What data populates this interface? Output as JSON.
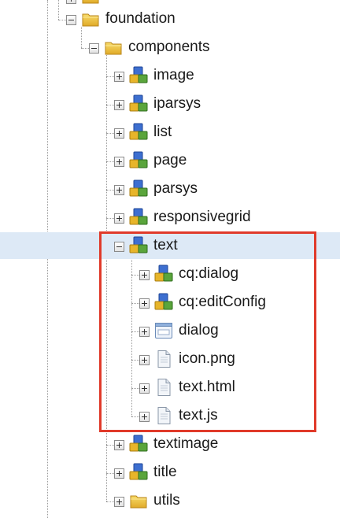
{
  "tree": {
    "rows": [
      {
        "label": "foundation",
        "icon": "folder-icon",
        "expanded": true,
        "level": 0
      },
      {
        "label": "components",
        "icon": "folder-icon",
        "expanded": true,
        "level": 1
      },
      {
        "label": "image",
        "icon": "component-icon",
        "expanded": false,
        "level": 2
      },
      {
        "label": "iparsys",
        "icon": "component-icon",
        "expanded": false,
        "level": 2
      },
      {
        "label": "list",
        "icon": "component-icon",
        "expanded": false,
        "level": 2
      },
      {
        "label": "page",
        "icon": "component-icon",
        "expanded": false,
        "level": 2
      },
      {
        "label": "parsys",
        "icon": "component-icon",
        "expanded": false,
        "level": 2
      },
      {
        "label": "responsivegrid",
        "icon": "component-icon",
        "expanded": false,
        "level": 2
      },
      {
        "label": "text",
        "icon": "component-icon",
        "expanded": true,
        "level": 2,
        "selected": true
      },
      {
        "label": "cq:dialog",
        "icon": "component-icon",
        "expanded": false,
        "level": 3
      },
      {
        "label": "cq:editConfig",
        "icon": "component-icon",
        "expanded": false,
        "level": 3
      },
      {
        "label": "dialog",
        "icon": "dialog-icon",
        "expanded": false,
        "level": 3
      },
      {
        "label": "icon.png",
        "icon": "file-icon",
        "expanded": false,
        "level": 3
      },
      {
        "label": "text.html",
        "icon": "file-icon",
        "expanded": false,
        "level": 3
      },
      {
        "label": "text.js",
        "icon": "file-icon",
        "expanded": false,
        "level": 3
      },
      {
        "label": "textimage",
        "icon": "component-icon",
        "expanded": false,
        "level": 2
      },
      {
        "label": "title",
        "icon": "component-icon",
        "expanded": false,
        "level": 2
      },
      {
        "label": "utils",
        "icon": "folder-icon",
        "expanded": false,
        "level": 2
      }
    ]
  },
  "highlight": {
    "color": "#e03a2a"
  },
  "colors": {
    "selection": "#dde9f6"
  }
}
